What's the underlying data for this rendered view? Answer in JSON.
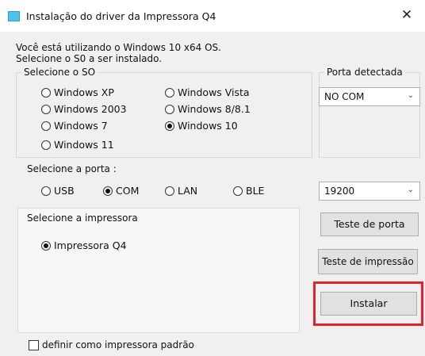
{
  "window": {
    "title": "Instalação do driver da Impressora Q4",
    "close_glyph": "✕"
  },
  "info": {
    "line1": "Você está utilizando o Windows 10 x64 OS.",
    "line2": "Selecione o S0 a ser instalado."
  },
  "os_group": {
    "label": "Selecione o SO",
    "options": [
      {
        "label": "Windows XP",
        "selected": false
      },
      {
        "label": "Windows Vista",
        "selected": false
      },
      {
        "label": "Windows 2003",
        "selected": false
      },
      {
        "label": "Windows 8/8.1",
        "selected": false
      },
      {
        "label": "Windows 7",
        "selected": false
      },
      {
        "label": "Windows 10",
        "selected": true
      },
      {
        "label": "Windows 11",
        "selected": false
      }
    ]
  },
  "port_detected": {
    "label": "Porta detectada",
    "value": "NO COM"
  },
  "port_group": {
    "label": "Selecione a porta :",
    "options": [
      {
        "label": "USB",
        "selected": false
      },
      {
        "label": "COM",
        "selected": true
      },
      {
        "label": "LAN",
        "selected": false
      },
      {
        "label": "BLE",
        "selected": false
      }
    ]
  },
  "baud": {
    "value": "19200"
  },
  "printer_group": {
    "label": "Selecione a impressora",
    "options": [
      {
        "label": "Impressora Q4",
        "selected": true
      }
    ]
  },
  "buttons": {
    "test_port": "Teste de porta",
    "test_print": "Teste de impressão",
    "install": "Instalar"
  },
  "default_printer": {
    "label": "definir como impressora padrão",
    "checked": false
  },
  "colors": {
    "highlight": "#e3222a",
    "window_bg": "#f0f0f0",
    "titlebar_bg": "#ffffff"
  },
  "icons": [
    "app-icon",
    "close-icon",
    "chevron-down-icon"
  ]
}
